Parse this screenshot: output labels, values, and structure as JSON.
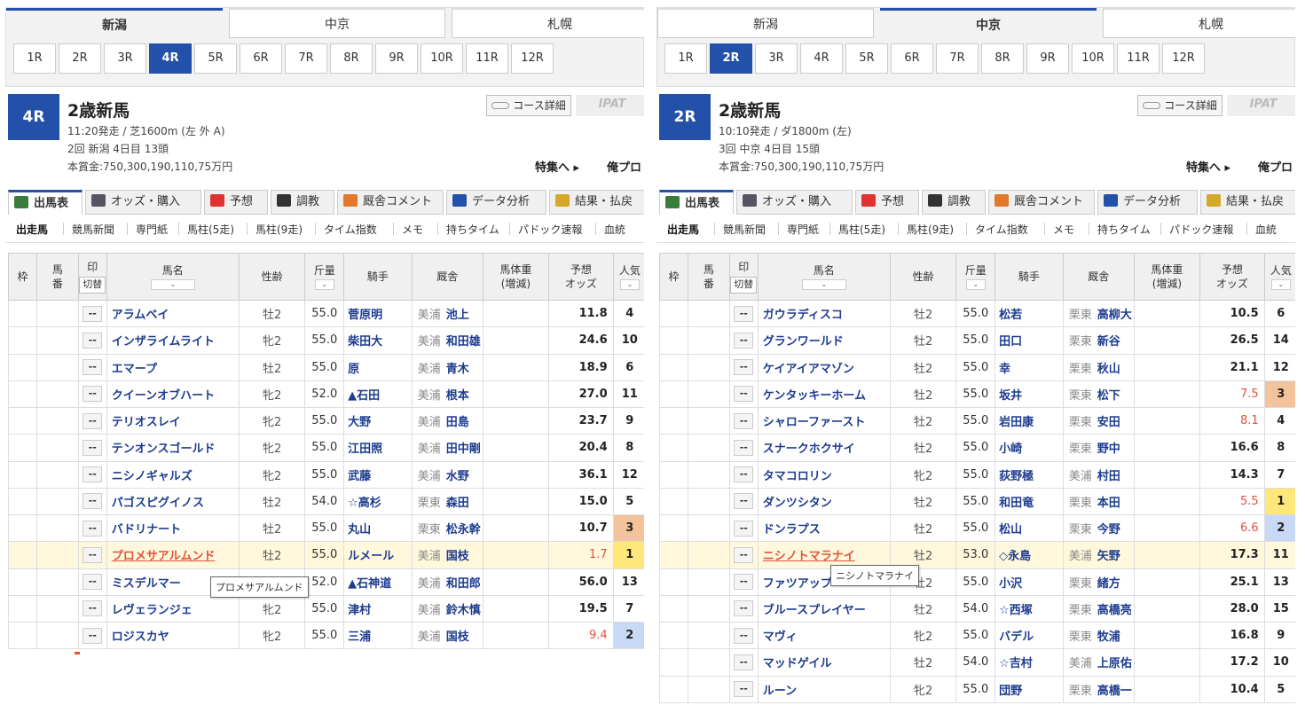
{
  "left": {
    "venue_tabs": [
      "新潟",
      "中京",
      "札幌"
    ],
    "active_venue": 0,
    "race_buttons": [
      "1R",
      "2R",
      "3R",
      "4R",
      "5R",
      "6R",
      "7R",
      "8R",
      "9R",
      "10R",
      "11R",
      "12R"
    ],
    "active_race": 3,
    "race_number": "4R",
    "race_name": "2歳新馬",
    "race_info_line1": "11:20発走 / 芝1600m (左 外 A)",
    "race_info_line2": "2回 新潟 4日目 13頭",
    "race_info_line3": "本賞金:750,300,190,110,75万円",
    "course_detail": "コース詳細",
    "ipat": "IPAT",
    "feature_link": "特集へ ▸",
    "ore_pro": "俺プロ",
    "main_tabs": [
      "出馬表",
      "オッズ・購入",
      "予想",
      "調教",
      "厩舎コメント",
      "データ分析",
      "結果・払戻"
    ],
    "sub_nav": [
      "出走馬",
      "競馬新聞",
      "専門紙",
      "馬柱(5走)",
      "馬柱(9走)",
      "タイム指数",
      "メモ",
      "持ちタイム",
      "パドック速報",
      "血統"
    ],
    "headers": {
      "waku": "枠",
      "uma": "馬\n番",
      "mark": "印",
      "switch": "切替",
      "horse": "馬名",
      "sex": "性齢",
      "weight": "斤量",
      "jockey": "騎手",
      "stable": "厩舎",
      "body": "馬体重\n(増減)",
      "odds": "予想\nオッズ",
      "pop": "人気"
    },
    "rows": [
      {
        "mark": "--",
        "horse": "アラムベイ",
        "sex": "牡2",
        "weight": "55.0",
        "jockey": "菅原明",
        "area": "美浦",
        "trainer": "池上",
        "odds": "11.8",
        "pop": "4"
      },
      {
        "mark": "--",
        "horse": "インザライムライト",
        "sex": "牝2",
        "weight": "55.0",
        "jockey": "柴田大",
        "area": "美浦",
        "trainer": "和田雄",
        "odds": "24.6",
        "pop": "10"
      },
      {
        "mark": "--",
        "horse": "エマープ",
        "sex": "牡2",
        "weight": "55.0",
        "jockey": "原",
        "area": "美浦",
        "trainer": "青木",
        "odds": "18.9",
        "pop": "6"
      },
      {
        "mark": "--",
        "horse": "クイーンオブハート",
        "sex": "牝2",
        "weight": "52.0",
        "jockey": "▲石田",
        "area": "美浦",
        "trainer": "根本",
        "odds": "27.0",
        "pop": "11"
      },
      {
        "mark": "--",
        "horse": "テリオスレイ",
        "sex": "牝2",
        "weight": "55.0",
        "jockey": "大野",
        "area": "美浦",
        "trainer": "田島",
        "odds": "23.7",
        "pop": "9"
      },
      {
        "mark": "--",
        "horse": "テンオンスゴールド",
        "sex": "牝2",
        "weight": "55.0",
        "jockey": "江田照",
        "area": "美浦",
        "trainer": "田中剛",
        "odds": "20.4",
        "pop": "8"
      },
      {
        "mark": "--",
        "horse": "ニシノギャルズ",
        "sex": "牝2",
        "weight": "55.0",
        "jockey": "武藤",
        "area": "美浦",
        "trainer": "水野",
        "odds": "36.1",
        "pop": "12"
      },
      {
        "mark": "--",
        "horse": "パゴスピグイノス",
        "sex": "牡2",
        "weight": "54.0",
        "jockey": "☆高杉",
        "area": "栗東",
        "trainer": "森田",
        "odds": "15.0",
        "pop": "5"
      },
      {
        "mark": "--",
        "horse": "バドリナート",
        "sex": "牡2",
        "weight": "55.0",
        "jockey": "丸山",
        "area": "栗東",
        "trainer": "松永幹",
        "odds": "10.7",
        "pop": "3"
      },
      {
        "mark": "--",
        "horse": "プロメサアルムンド",
        "sex": "牡2",
        "weight": "55.0",
        "jockey": "ルメール",
        "area": "美浦",
        "trainer": "国枝",
        "odds": "1.7",
        "pop": "1"
      },
      {
        "mark": "--",
        "horse": "ミスデルマー",
        "sex": "牝2",
        "weight": "52.0",
        "jockey": "▲石神道",
        "area": "美浦",
        "trainer": "和田郎",
        "odds": "56.0",
        "pop": "13"
      },
      {
        "mark": "--",
        "horse": "レヴェランジェ",
        "sex": "牝2",
        "weight": "55.0",
        "jockey": "津村",
        "area": "美浦",
        "trainer": "鈴木慎",
        "odds": "19.5",
        "pop": "7"
      },
      {
        "mark": "--",
        "horse": "ロジスカヤ",
        "sex": "牝2",
        "weight": "55.0",
        "jockey": "三浦",
        "area": "美浦",
        "trainer": "国枝",
        "odds": "9.4",
        "pop": "2"
      }
    ],
    "tooltip": "プロメサアルムンド"
  },
  "right": {
    "venue_tabs": [
      "新潟",
      "中京",
      "札幌"
    ],
    "active_venue": 1,
    "race_buttons": [
      "1R",
      "2R",
      "3R",
      "4R",
      "5R",
      "6R",
      "7R",
      "8R",
      "9R",
      "10R",
      "11R",
      "12R"
    ],
    "active_race": 1,
    "race_number": "2R",
    "race_name": "2歳新馬",
    "race_info_line1": "10:10発走 / ダ1800m (左)",
    "race_info_line2": "3回 中京 4日目 15頭",
    "race_info_line3": "本賞金:750,300,190,110,75万円",
    "course_detail": "コース詳細",
    "ipat": "IPAT",
    "feature_link": "特集へ ▸",
    "ore_pro": "俺プロ",
    "main_tabs": [
      "出馬表",
      "オッズ・購入",
      "予想",
      "調教",
      "厩舎コメント",
      "データ分析",
      "結果・払戻"
    ],
    "sub_nav": [
      "出走馬",
      "競馬新聞",
      "専門紙",
      "馬柱(5走)",
      "馬柱(9走)",
      "タイム指数",
      "メモ",
      "持ちタイム",
      "パドック速報",
      "血統"
    ],
    "headers": {
      "waku": "枠",
      "uma": "馬\n番",
      "mark": "印",
      "switch": "切替",
      "horse": "馬名",
      "sex": "性齢",
      "weight": "斤量",
      "jockey": "騎手",
      "stable": "厩舎",
      "body": "馬体重\n(増減)",
      "odds": "予想\nオッズ",
      "pop": "人気"
    },
    "rows": [
      {
        "mark": "--",
        "horse": "ガウラディスコ",
        "sex": "牡2",
        "weight": "55.0",
        "jockey": "松若",
        "area": "栗東",
        "trainer": "高柳大",
        "odds": "10.5",
        "pop": "6"
      },
      {
        "mark": "--",
        "horse": "グランワールド",
        "sex": "牡2",
        "weight": "55.0",
        "jockey": "田口",
        "area": "栗東",
        "trainer": "新谷",
        "odds": "26.5",
        "pop": "14"
      },
      {
        "mark": "--",
        "horse": "ケイアイアマゾン",
        "sex": "牡2",
        "weight": "55.0",
        "jockey": "幸",
        "area": "栗東",
        "trainer": "秋山",
        "odds": "21.1",
        "pop": "12"
      },
      {
        "mark": "--",
        "horse": "ケンタッキーホーム",
        "sex": "牡2",
        "weight": "55.0",
        "jockey": "坂井",
        "area": "栗東",
        "trainer": "松下",
        "odds": "7.5",
        "pop": "3"
      },
      {
        "mark": "--",
        "horse": "シャローファースト",
        "sex": "牡2",
        "weight": "55.0",
        "jockey": "岩田康",
        "area": "栗東",
        "trainer": "安田",
        "odds": "8.1",
        "pop": "4"
      },
      {
        "mark": "--",
        "horse": "スナークホクサイ",
        "sex": "牡2",
        "weight": "55.0",
        "jockey": "小崎",
        "area": "栗東",
        "trainer": "野中",
        "odds": "16.6",
        "pop": "8"
      },
      {
        "mark": "--",
        "horse": "タマコロリン",
        "sex": "牝2",
        "weight": "55.0",
        "jockey": "荻野極",
        "area": "美浦",
        "trainer": "村田",
        "odds": "14.3",
        "pop": "7"
      },
      {
        "mark": "--",
        "horse": "ダンツシタン",
        "sex": "牡2",
        "weight": "55.0",
        "jockey": "和田竜",
        "area": "栗東",
        "trainer": "本田",
        "odds": "5.5",
        "pop": "1"
      },
      {
        "mark": "--",
        "horse": "ドンラプス",
        "sex": "牡2",
        "weight": "55.0",
        "jockey": "松山",
        "area": "栗東",
        "trainer": "今野",
        "odds": "6.6",
        "pop": "2"
      },
      {
        "mark": "--",
        "horse": "ニシノトマラナイ",
        "sex": "牡2",
        "weight": "53.0",
        "jockey": "◇永島",
        "area": "美浦",
        "trainer": "矢野",
        "odds": "17.3",
        "pop": "11"
      },
      {
        "mark": "--",
        "horse": "ファツアップ",
        "sex": "牡2",
        "weight": "55.0",
        "jockey": "小沢",
        "area": "栗東",
        "trainer": "緒方",
        "odds": "25.1",
        "pop": "13"
      },
      {
        "mark": "--",
        "horse": "ブルースプレイヤー",
        "sex": "牡2",
        "weight": "54.0",
        "jockey": "☆西塚",
        "area": "栗東",
        "trainer": "高橋亮",
        "odds": "28.0",
        "pop": "15"
      },
      {
        "mark": "--",
        "horse": "マヴィ",
        "sex": "牝2",
        "weight": "55.0",
        "jockey": "バデル",
        "area": "栗東",
        "trainer": "牧浦",
        "odds": "16.8",
        "pop": "9"
      },
      {
        "mark": "--",
        "horse": "マッドゲイル",
        "sex": "牡2",
        "weight": "54.0",
        "jockey": "☆吉村",
        "area": "美浦",
        "trainer": "上原佑",
        "odds": "17.2",
        "pop": "10"
      },
      {
        "mark": "--",
        "horse": "ルーン",
        "sex": "牝2",
        "weight": "55.0",
        "jockey": "団野",
        "area": "栗東",
        "trainer": "高橋一",
        "odds": "10.4",
        "pop": "5"
      }
    ],
    "tooltip": "ニシノトマラナイ"
  },
  "colors": {
    "accent": "#2350a8",
    "horse_link": "#1d3c8f",
    "highlight_red": "#e0533b",
    "pop1": "#ffe77a",
    "pop2": "#c7d9f4",
    "pop3": "#f3c39b",
    "selected_row": "#fff8dc"
  },
  "tab_icons": [
    "table-icon",
    "odds-chart-icon",
    "target-icon",
    "stopwatch-icon",
    "stable-hat-icon",
    "bar-chart-icon",
    "coins-icon"
  ]
}
